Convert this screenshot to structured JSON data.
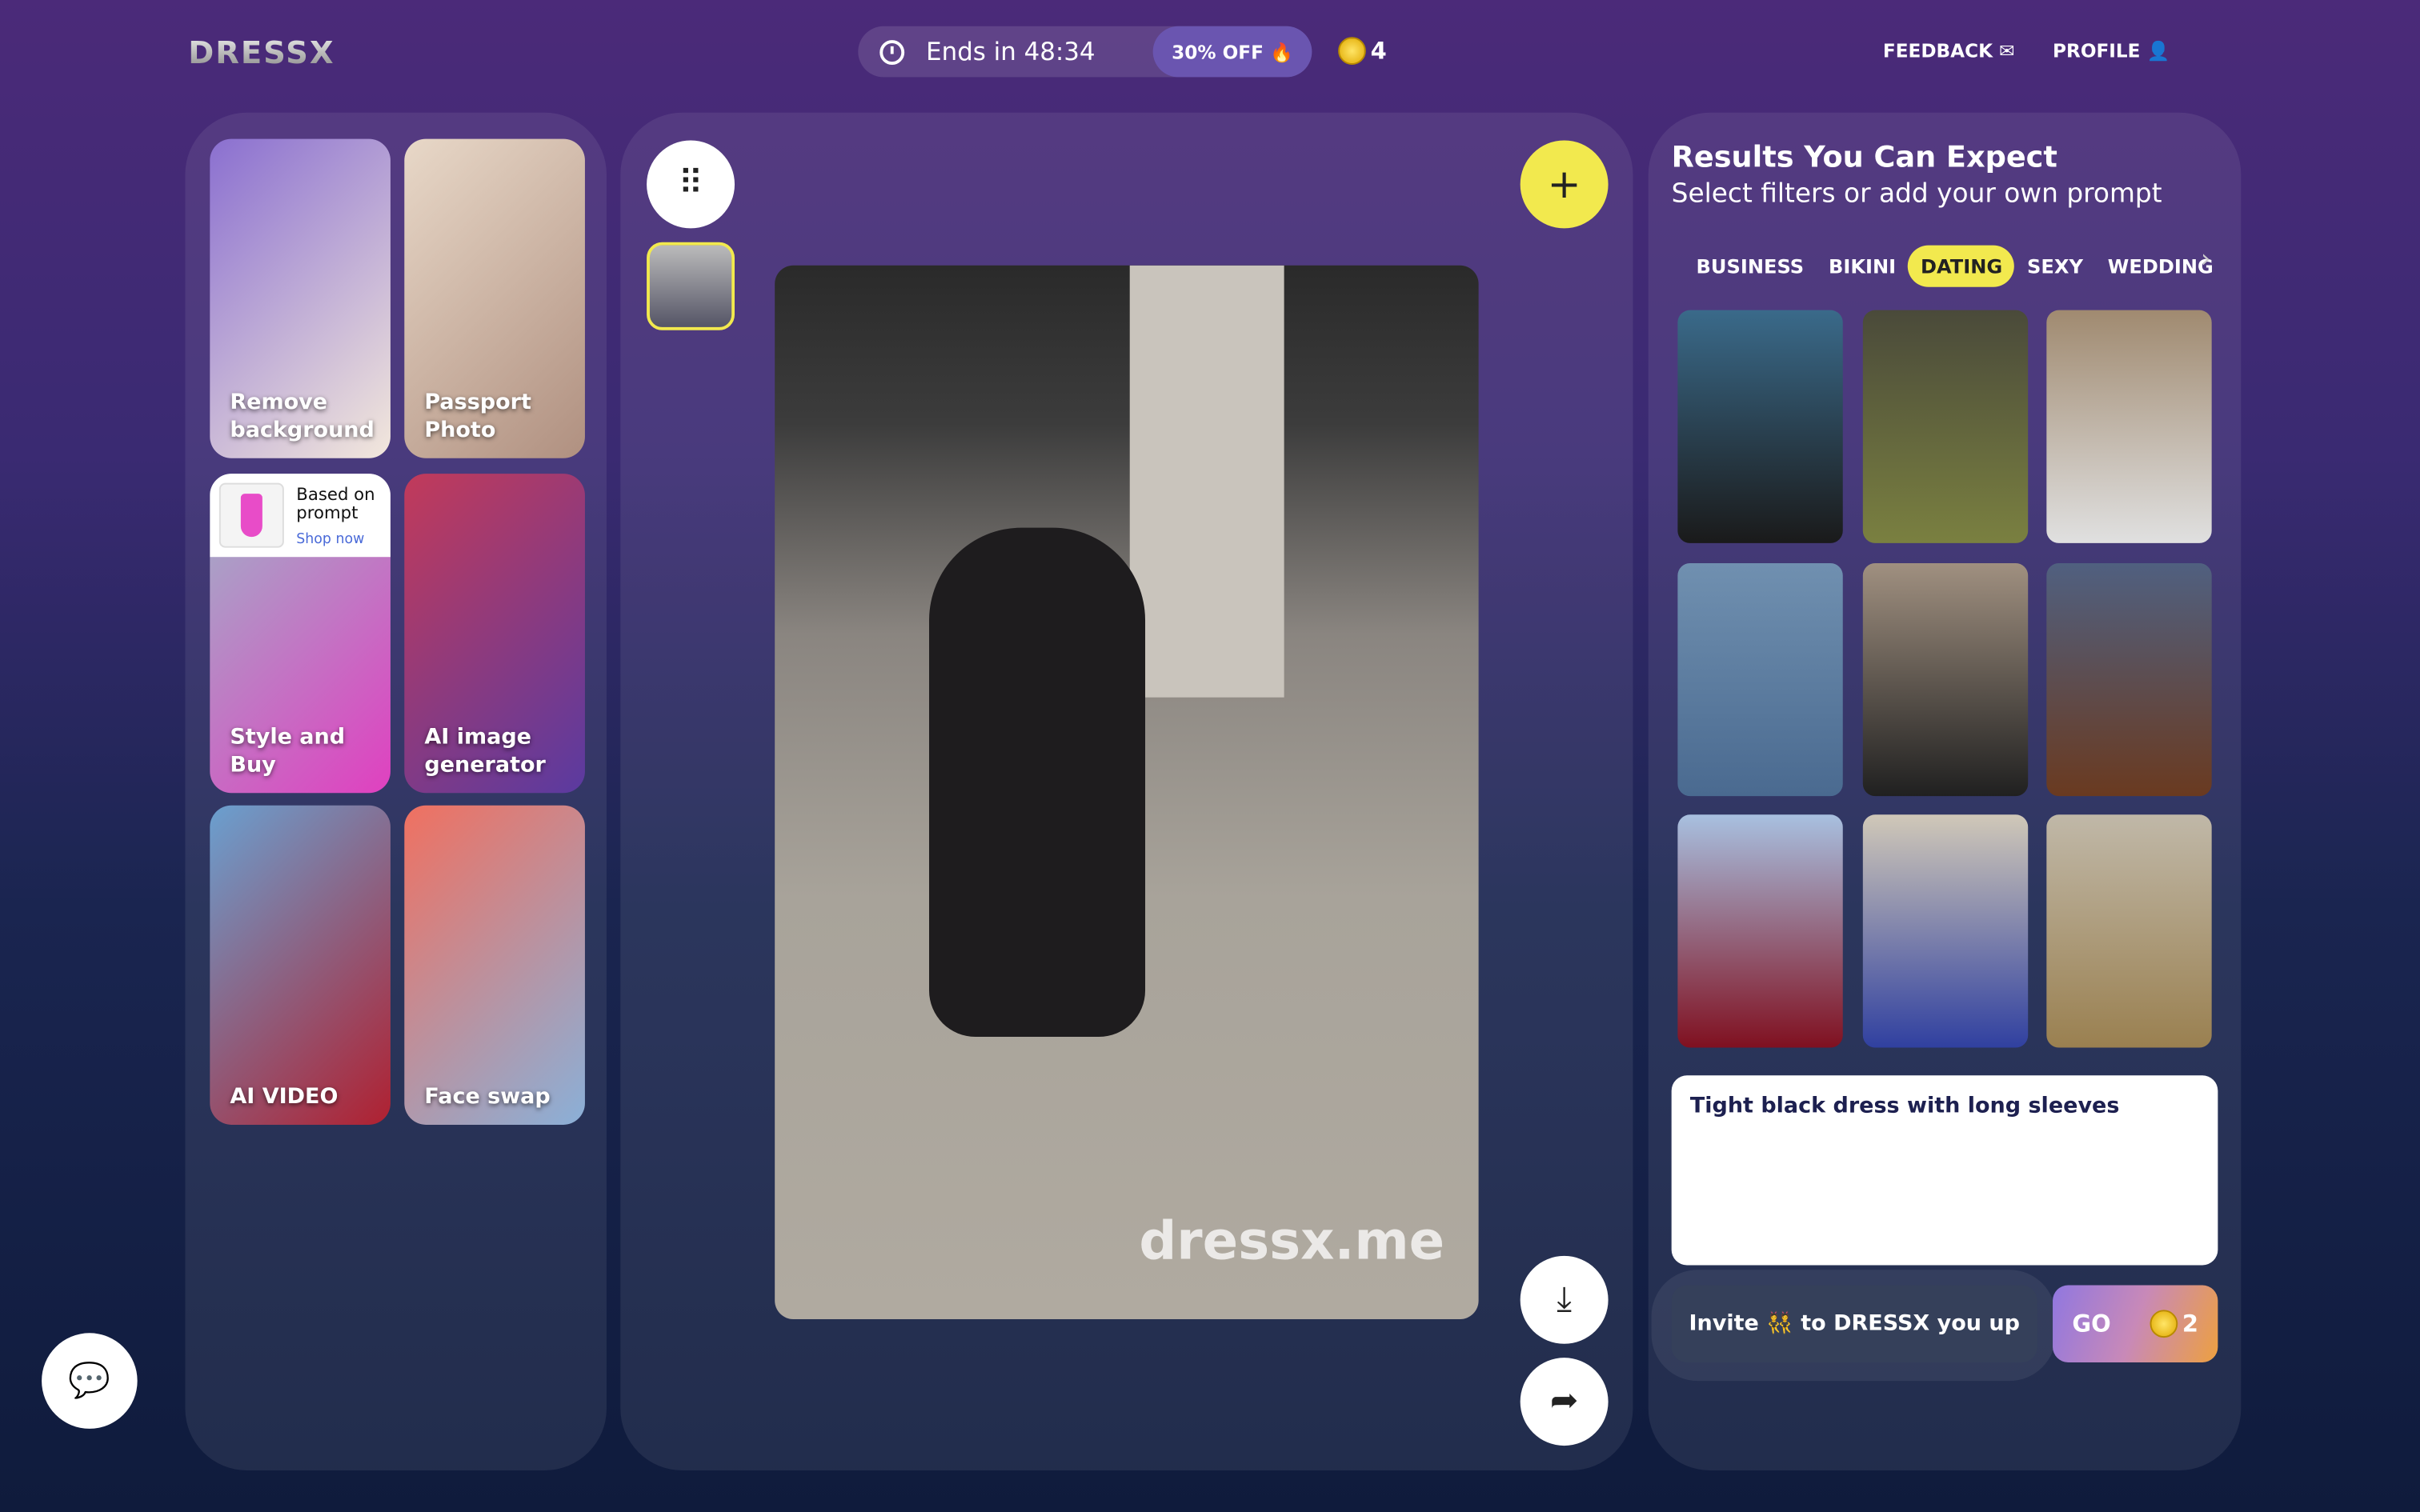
{
  "header": {
    "logo": "DRESSX",
    "timer": "Ends in 48:34",
    "discount": "30% OFF 🔥",
    "coins": "4",
    "feedback": "FEEDBACK ✉",
    "profile": "PROFILE 👤"
  },
  "tools": [
    {
      "label": "Remove background",
      "colors": [
        "#8a6fd0",
        "#f3e8dc"
      ]
    },
    {
      "label": "Passport Photo",
      "colors": [
        "#e8d8c8",
        "#b09080"
      ]
    },
    {
      "label": "Style and Buy",
      "colors": [
        "#9fb3c8",
        "#e040c0"
      ],
      "card_title": "Based on prompt",
      "card_link": "Shop now"
    },
    {
      "label": "AI image generator",
      "colors": [
        "#c23a5a",
        "#5a3aa0"
      ]
    },
    {
      "label": "AI VIDEO",
      "colors": [
        "#6aa0d0",
        "#b02030"
      ]
    },
    {
      "label": "Face swap",
      "colors": [
        "#f07060",
        "#8ab0d8"
      ]
    }
  ],
  "editor": {
    "watermark": "dressx.me",
    "icons": [
      "grid-icon",
      "plus-icon",
      "download-icon",
      "share-icon"
    ]
  },
  "results": {
    "title": "Results You Can Expect",
    "subtitle": "Select filters or add your own prompt",
    "tabs": [
      "BUSINESS",
      "BIKINI",
      "DATING",
      "SEXY",
      "WEDDING"
    ],
    "active_tab": "DATING",
    "images": [
      [
        "#3a6a8a",
        "#1a1a1a"
      ],
      [
        "#4a4a3a",
        "#7a8040"
      ],
      [
        "#a08a70",
        "#e0e0e0"
      ],
      [
        "#7090b0",
        "#4a6a90"
      ],
      [
        "#a09080",
        "#202020"
      ],
      [
        "#506080",
        "#6a3a20"
      ],
      [
        "#a8c0e0",
        "#801020"
      ],
      [
        "#d0c8b8",
        "#3040a0"
      ],
      [
        "#c0b8a8",
        "#9a8050"
      ]
    ],
    "prompt": "Tight black dress with long sleeves",
    "invite": "Invite 👯 to DRESSX you up",
    "go": "GO",
    "go_cost": "2"
  },
  "colors": {
    "accent": "#f2e94e",
    "bg_top": "#4b2a79",
    "bg_bottom": "#0f1b3c"
  }
}
